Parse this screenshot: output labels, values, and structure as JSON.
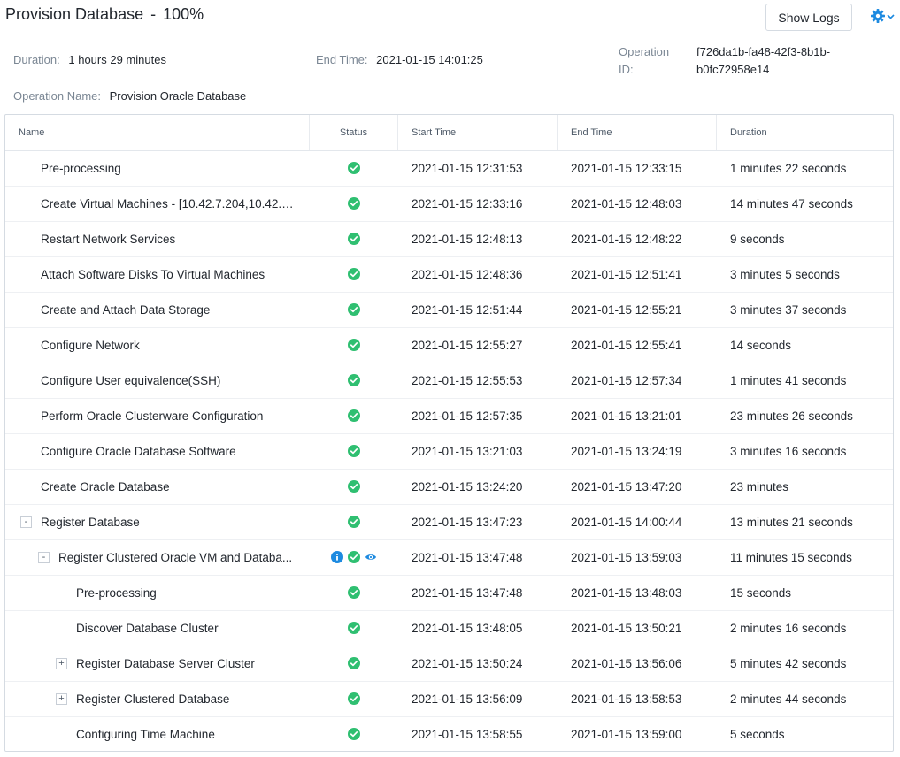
{
  "header": {
    "title": "Provision Database",
    "separator": "-",
    "progress": "100%",
    "show_logs_label": "Show Logs",
    "gear_icon": "gear-icon",
    "accent_color": "#1d8ae0"
  },
  "meta": {
    "duration_label": "Duration:",
    "duration_value": "1 hours 29 minutes",
    "end_time_label": "End Time:",
    "end_time_value": "2021-01-15 14:01:25",
    "operation_id_label": "Operation ID:",
    "operation_id_value": "f726da1b-fa48-42f3-8b1b-b0fc72958e14",
    "operation_name_label": "Operation Name:",
    "operation_name_value": "Provision Oracle Database"
  },
  "table": {
    "columns": [
      "Name",
      "Status",
      "Start Time",
      "End Time",
      "Duration"
    ],
    "status_color": "#2fbf71",
    "info_color": "#1d8ae0",
    "rows": [
      {
        "name": "Pre-processing",
        "level": 0,
        "toggle": "",
        "icons": [
          "success"
        ],
        "start": "2021-01-15 12:31:53",
        "end": "2021-01-15 12:33:15",
        "duration": "1 minutes 22 seconds"
      },
      {
        "name": "Create Virtual Machines - [10.42.7.204,10.42.7....",
        "level": 0,
        "toggle": "",
        "icons": [
          "success"
        ],
        "start": "2021-01-15 12:33:16",
        "end": "2021-01-15 12:48:03",
        "duration": "14 minutes 47 seconds"
      },
      {
        "name": "Restart Network Services",
        "level": 0,
        "toggle": "",
        "icons": [
          "success"
        ],
        "start": "2021-01-15 12:48:13",
        "end": "2021-01-15 12:48:22",
        "duration": "9 seconds"
      },
      {
        "name": "Attach Software Disks To Virtual Machines",
        "level": 0,
        "toggle": "",
        "icons": [
          "success"
        ],
        "start": "2021-01-15 12:48:36",
        "end": "2021-01-15 12:51:41",
        "duration": "3 minutes 5 seconds"
      },
      {
        "name": "Create and Attach Data Storage",
        "level": 0,
        "toggle": "",
        "icons": [
          "success"
        ],
        "start": "2021-01-15 12:51:44",
        "end": "2021-01-15 12:55:21",
        "duration": "3 minutes 37 seconds"
      },
      {
        "name": "Configure Network",
        "level": 0,
        "toggle": "",
        "icons": [
          "success"
        ],
        "start": "2021-01-15 12:55:27",
        "end": "2021-01-15 12:55:41",
        "duration": "14 seconds"
      },
      {
        "name": "Configure User equivalence(SSH)",
        "level": 0,
        "toggle": "",
        "icons": [
          "success"
        ],
        "start": "2021-01-15 12:55:53",
        "end": "2021-01-15 12:57:34",
        "duration": "1 minutes 41 seconds"
      },
      {
        "name": "Perform Oracle Clusterware Configuration",
        "level": 0,
        "toggle": "",
        "icons": [
          "success"
        ],
        "start": "2021-01-15 12:57:35",
        "end": "2021-01-15 13:21:01",
        "duration": "23 minutes 26 seconds"
      },
      {
        "name": "Configure Oracle Database Software",
        "level": 0,
        "toggle": "",
        "icons": [
          "success"
        ],
        "start": "2021-01-15 13:21:03",
        "end": "2021-01-15 13:24:19",
        "duration": "3 minutes 16 seconds"
      },
      {
        "name": "Create Oracle Database",
        "level": 0,
        "toggle": "",
        "icons": [
          "success"
        ],
        "start": "2021-01-15 13:24:20",
        "end": "2021-01-15 13:47:20",
        "duration": "23 minutes"
      },
      {
        "name": "Register Database",
        "level": 0,
        "toggle": "-",
        "icons": [
          "success"
        ],
        "start": "2021-01-15 13:47:23",
        "end": "2021-01-15 14:00:44",
        "duration": "13 minutes 21 seconds"
      },
      {
        "name": "Register Clustered Oracle VM and Databa...",
        "level": 1,
        "toggle": "-",
        "icons": [
          "info",
          "success",
          "eye"
        ],
        "start": "2021-01-15 13:47:48",
        "end": "2021-01-15 13:59:03",
        "duration": "11 minutes 15 seconds"
      },
      {
        "name": "Pre-processing",
        "level": 2,
        "toggle": "",
        "icons": [
          "success"
        ],
        "start": "2021-01-15 13:47:48",
        "end": "2021-01-15 13:48:03",
        "duration": "15 seconds"
      },
      {
        "name": "Discover Database Cluster",
        "level": 2,
        "toggle": "",
        "icons": [
          "success"
        ],
        "start": "2021-01-15 13:48:05",
        "end": "2021-01-15 13:50:21",
        "duration": "2 minutes 16 seconds"
      },
      {
        "name": "Register Database Server Cluster",
        "level": 2,
        "toggle": "+",
        "icons": [
          "success"
        ],
        "start": "2021-01-15 13:50:24",
        "end": "2021-01-15 13:56:06",
        "duration": "5 minutes 42 seconds"
      },
      {
        "name": "Register Clustered Database",
        "level": 2,
        "toggle": "+",
        "icons": [
          "success"
        ],
        "start": "2021-01-15 13:56:09",
        "end": "2021-01-15 13:58:53",
        "duration": "2 minutes 44 seconds"
      },
      {
        "name": "Configuring Time Machine",
        "level": 2,
        "toggle": "",
        "icons": [
          "success"
        ],
        "start": "2021-01-15 13:58:55",
        "end": "2021-01-15 13:59:00",
        "duration": "5 seconds"
      }
    ]
  }
}
